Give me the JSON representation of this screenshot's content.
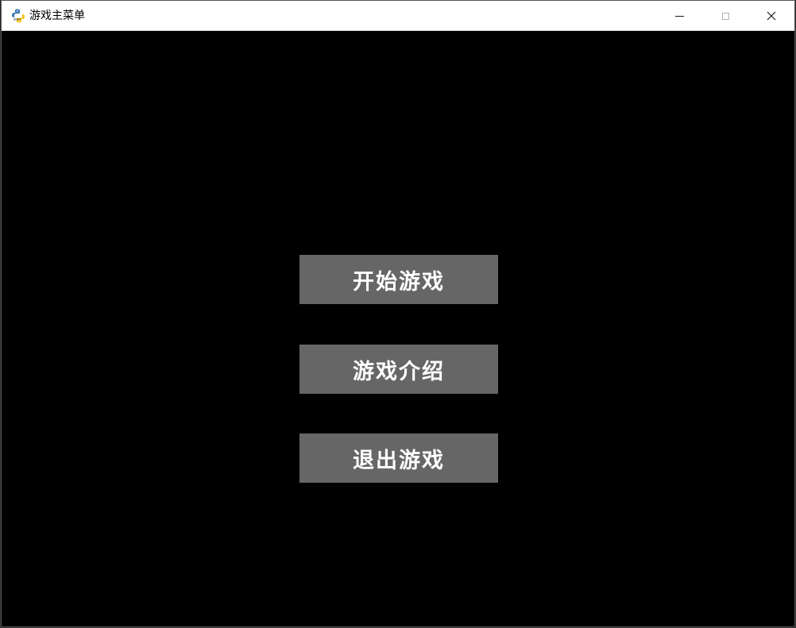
{
  "window": {
    "title": "游戏主菜单",
    "icon": "pygame-snake-icon",
    "controls": {
      "minimize": "minimize-icon",
      "maximize": "maximize-icon",
      "close": "close-icon"
    }
  },
  "menu": {
    "background_color": "#000000",
    "button_color": "#666666",
    "text_color": "#ffffff",
    "buttons": [
      {
        "label": "开始游戏"
      },
      {
        "label": "游戏介绍"
      },
      {
        "label": "退出游戏"
      }
    ]
  }
}
